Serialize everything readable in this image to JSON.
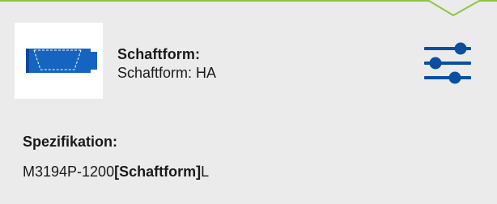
{
  "accent_color": "#8cc63f",
  "icon_color": "#0a4fa0",
  "product": {
    "image_icon": "shank-form-ha-icon",
    "title_label": "Schaftform:",
    "title_value": "Schaftform: HA",
    "filter_icon": "sliders-icon"
  },
  "specification": {
    "label": "Spezifikation:",
    "prefix": "M3194P-1200",
    "placeholder": "[Schaftform]",
    "suffix": "L"
  }
}
